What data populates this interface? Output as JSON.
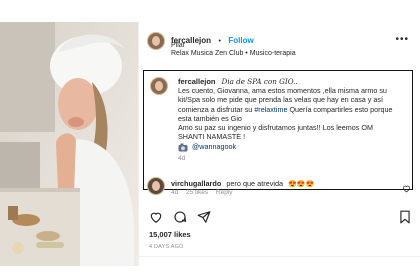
{
  "post": {
    "author": "fercallejon",
    "dot": "•",
    "follow_label": "Follow",
    "location": "Pilar",
    "audio": "Relax Musica Zen Club • Musico-terapia",
    "caption_author": "fercallejon",
    "caption_title": "Dia de SPA con GIO..",
    "caption_lines": [
      "Les cuento, Giovanna, ama estos momentos ,ella misma armo su",
      "kit/Spa solo me pide que prenda las velas que hay en casa y así",
      "comienza a disfrutar su",
      "#relaxtime",
      " Quería compartirles esto porque",
      "esta también es Gio",
      "Amo su paz su ingenio y disfrutamos juntas!! Los leemos OM",
      "SHANTI NAMASTE !"
    ],
    "tagged_user": "@wannagook",
    "caption_age": "4d",
    "comment_user": "virchugallardo",
    "comment_text": "pero que atrevida",
    "comment_emojis": "😍😍😍",
    "comment_age": "4d",
    "comment_likes": "25 likes",
    "comment_reply": "Reply",
    "likes": "15,007 likes",
    "time_ago": "4 DAYS AGO"
  }
}
